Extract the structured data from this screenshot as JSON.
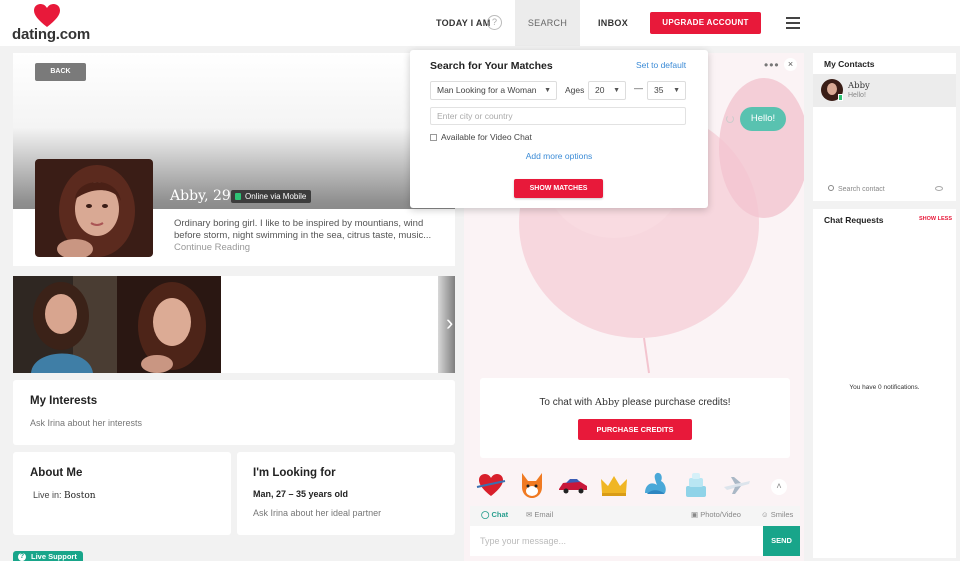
{
  "brand": {
    "logo_text": "dating.com",
    "accent": "#e8193a",
    "teal": "#18a58a"
  },
  "header": {
    "nav": {
      "today": "TODAY I AM",
      "search": "SEARCH",
      "inbox": "INBOX"
    },
    "help": "?",
    "upgrade": "UPGRADE ACCOUNT"
  },
  "profile": {
    "back": "BACK",
    "name": "Abby, 29",
    "status": "Online via Mobile",
    "bio": "Ordinary boring girl. I like to be inspired by mountians, wind before storm, night swimming in the sea, citrus taste, music...",
    "continue": "Continue Reading",
    "arrow": "›"
  },
  "interests": {
    "title": "My Interests",
    "sub": "Ask Irina about her interests"
  },
  "about": {
    "title": "About Me",
    "live_label": "Live in:",
    "city": "Boston"
  },
  "looking": {
    "title": "I'm Looking for",
    "detail": "Man, 27 – 35 years old",
    "sub": "Ask Irina about her ideal partner"
  },
  "live_support": "Live Support",
  "search_popup": {
    "title": "Search for Your Matches",
    "set_default": "Set to default",
    "gender": "Man Looking for a Woman",
    "ages_label": "Ages",
    "age_from": "20",
    "dash": "—",
    "age_to": "35",
    "city_placeholder": "Enter city or country",
    "video_chat_label": "Available for Video Chat",
    "more": "Add more options",
    "submit": "SHOW MATCHES"
  },
  "chat": {
    "dots": "•••",
    "close": "×",
    "hello": "Hello!",
    "credits_prefix": "To chat with",
    "credits_name": "Abby",
    "credits_suffix": "please purchase credits!",
    "purchase": "PURCHASE CREDITS",
    "gifts": [
      "heart-gift",
      "fox-gift",
      "car-gift",
      "crown-gift",
      "swan-gift",
      "cake-gift",
      "plane-gift"
    ],
    "gifts_up": "˄",
    "tabs": {
      "chat": "Chat",
      "email": "Email",
      "photo": "Photo/Video",
      "smiles": "Smiles"
    },
    "placeholder": "Type your message...",
    "send": "SEND"
  },
  "contacts": {
    "title": "My Contacts",
    "items": [
      {
        "name": "Abby",
        "message": "Hello!"
      }
    ],
    "search": "Search contact"
  },
  "requests": {
    "title": "Chat Requests",
    "show_less": "SHOW LESS",
    "empty": "You have 0 notifications."
  }
}
